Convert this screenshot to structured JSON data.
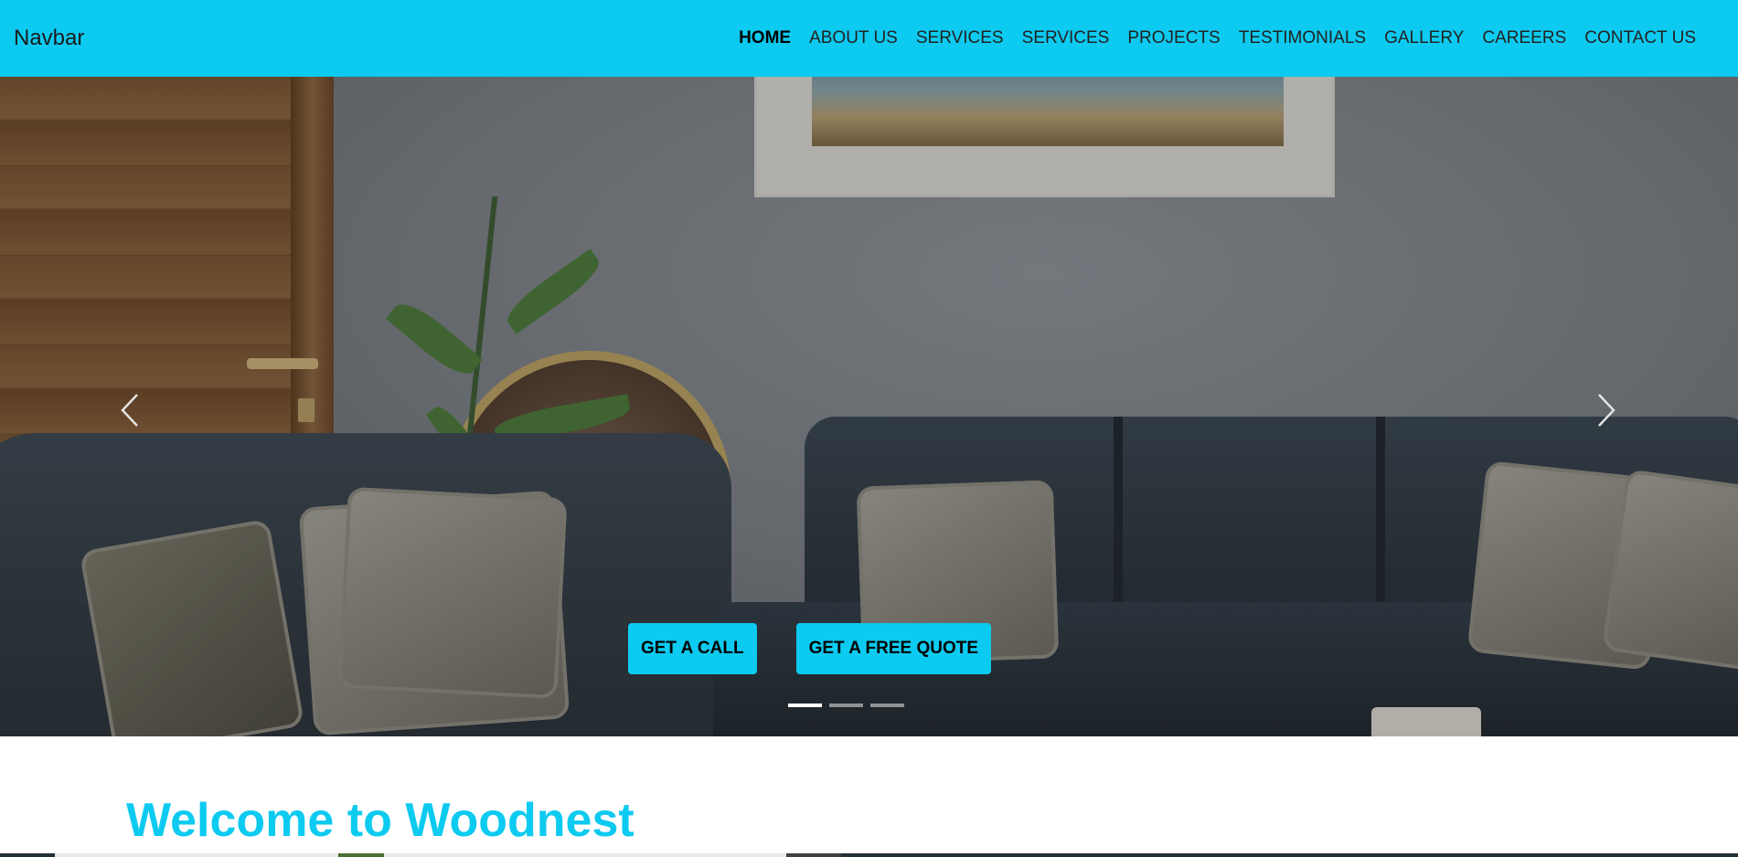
{
  "navbar": {
    "brand": "Navbar",
    "links": [
      {
        "label": "HOME",
        "active": true
      },
      {
        "label": "ABOUT US",
        "active": false
      },
      {
        "label": "SERVICES",
        "active": false
      },
      {
        "label": "SERVICES",
        "active": false
      },
      {
        "label": "PROJECTS",
        "active": false
      },
      {
        "label": "TESTIMONIALS",
        "active": false
      },
      {
        "label": "GALLERY",
        "active": false
      },
      {
        "label": "CAREERS",
        "active": false
      },
      {
        "label": "CONTACT US",
        "active": false
      }
    ]
  },
  "hero": {
    "buttons": {
      "call_label": "GET A CALL",
      "quote_label": "GET A FREE QUOTE"
    },
    "controls": {
      "prev_icon": "chevron-left-icon",
      "next_icon": "chevron-right-icon"
    },
    "slides_count": 3,
    "active_slide": 1
  },
  "welcome": {
    "heading": "Welcome to Woodnest"
  },
  "colors": {
    "accent": "#0dcaf0",
    "nav_text": "#222222",
    "heading": "#0dcaf0"
  }
}
